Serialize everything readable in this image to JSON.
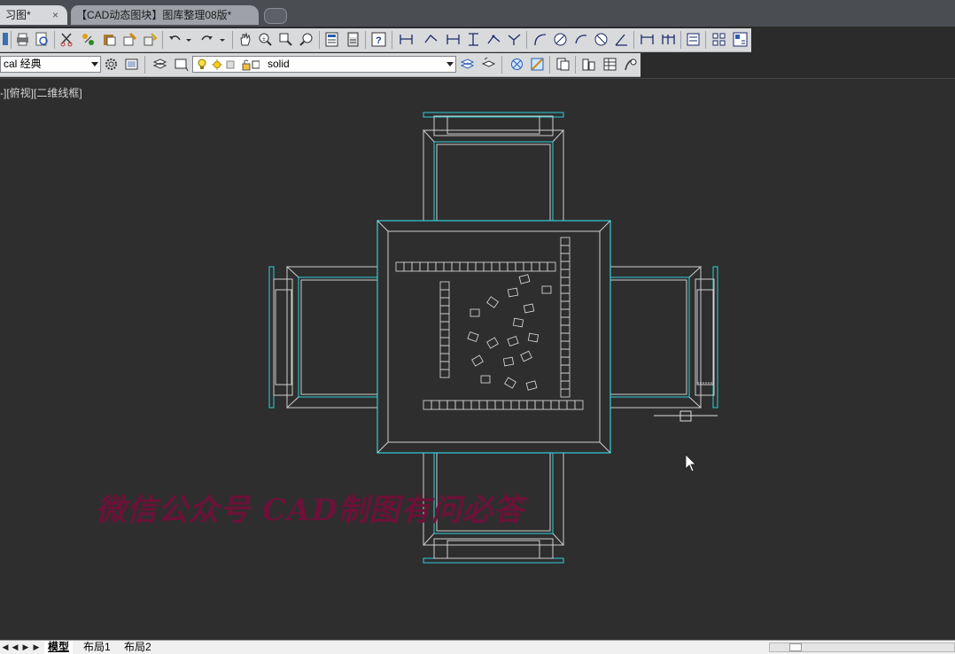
{
  "tabs": [
    {
      "label": "习图*",
      "close": "×"
    },
    {
      "label": "【CAD动态图块】图库整理08版*"
    }
  ],
  "toolbar2": {
    "workspace_value": "cal 经典",
    "linetype_value": "solid"
  },
  "viewport": {
    "label": "-][俯视][二维线框]"
  },
  "watermark": "微信公众号  CAD制图有问必答",
  "layout_tabs": [
    "模型",
    "布局1",
    "布局2"
  ],
  "colors": {
    "drawing_lines": "#cfcfcf",
    "highlight": "#2fd0d8",
    "background": "#2e2e2e",
    "watermark": "#6b1238"
  },
  "icons": [
    "print-icon",
    "preview-icon",
    "cut-icon",
    "match-properties-icon",
    "undo-icon",
    "redo-icon",
    "pan-icon",
    "zoom-realtime-icon",
    "zoom-window-icon",
    "zoom-previous-icon",
    "properties-icon",
    "calculator-icon",
    "help-icon",
    "dimension-icon",
    "aligned-dimension-icon",
    "arc-dimension-icon",
    "radius-icon",
    "diameter-icon",
    "angular-icon",
    "layer-icon",
    "color-icon",
    "linetype-icon"
  ]
}
